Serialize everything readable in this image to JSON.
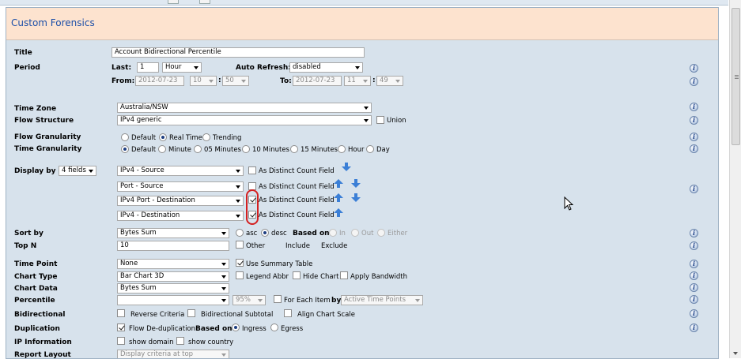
{
  "panel": {
    "title": "Custom Forensics"
  },
  "labels": {
    "title": "Title",
    "period": "Period",
    "time_zone": "Time Zone",
    "flow_structure": "Flow Structure",
    "flow_granularity": "Flow Granularity",
    "time_granularity": "Time Granularity",
    "display_by": "Display by",
    "sort_by": "Sort by",
    "top_n": "Top N",
    "time_point": "Time Point",
    "chart_type": "Chart Type",
    "chart_data": "Chart Data",
    "percentile": "Percentile",
    "bidirectional": "Bidirectional",
    "duplication": "Duplication",
    "ip_information": "IP Information",
    "report_layout": "Report Layout"
  },
  "title_value": "Account Bidirectional Percentile",
  "period": {
    "last_label": "Last:",
    "last_value": "1",
    "unit": "Hour",
    "auto_refresh_label": "Auto Refresh:",
    "auto_refresh_value": "disabled",
    "from_label": "From:",
    "from_date": "2012-07-23",
    "from_hour": "10",
    "from_min": "50",
    "to_label": "To:",
    "to_date": "2012-07-23",
    "to_hour": "11",
    "to_min": "49",
    "colon": ":"
  },
  "time_zone": "Australia/NSW",
  "flow_structure": {
    "value": "IPv4 generic",
    "union_label": "Union"
  },
  "flow_granularity": {
    "options": [
      "Default",
      "Real Time",
      "Trending"
    ],
    "selected": "Real Time"
  },
  "time_granularity": {
    "options": [
      "Default",
      "Minute",
      "05 Minutes",
      "10 Minutes",
      "15 Minutes",
      "Hour",
      "Day"
    ],
    "selected": "Default"
  },
  "display_by": {
    "fields_count": "4 fields",
    "distinct_label": "As Distinct Count Field",
    "fields": [
      "IPv4 - Source",
      "Port - Source",
      "IPv4 Port - Destination",
      "IPv4 - Destination"
    ]
  },
  "sort_by": {
    "value": "Bytes Sum",
    "asc": "asc",
    "desc": "desc",
    "based_on": "Based on",
    "in": "In",
    "out": "Out",
    "either": "Either"
  },
  "top_n": {
    "value": "10",
    "other": "Other",
    "include": "Include",
    "exclude": "Exclude"
  },
  "time_point": {
    "value": "None",
    "use_summary": "Use Summary Table"
  },
  "chart_type": {
    "value": "Bar Chart 3D",
    "legend_abbr": "Legend Abbr",
    "hide_chart": "Hide Chart",
    "apply_bandwidth": "Apply Bandwidth"
  },
  "chart_data": {
    "value": "Bytes Sum"
  },
  "percentile": {
    "pct": "95%",
    "for_each": "For Each Item",
    "by": "by",
    "by_value": "Active Time Points"
  },
  "bidirectional": {
    "reverse": "Reverse Criteria",
    "subtotal": "Bidirectional Subtotal",
    "align": "Align Chart Scale"
  },
  "duplication": {
    "flow_dedup": "Flow De-duplication",
    "based_on": "Based on",
    "ingress": "Ingress",
    "egress": "Egress"
  },
  "ip_information": {
    "show_domain": "show domain",
    "show_country": "show country"
  },
  "report_layout": {
    "value": "Display criteria at top"
  },
  "icons": {
    "info": "i"
  }
}
